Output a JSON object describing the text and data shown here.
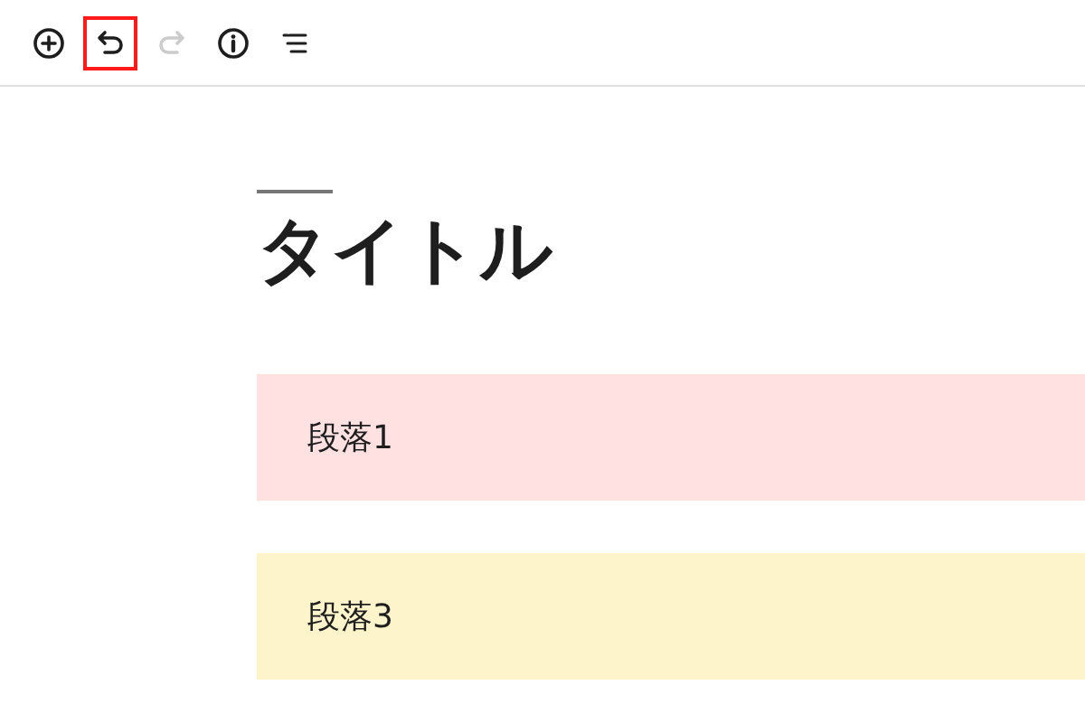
{
  "toolbar": [
    {
      "kind": "add",
      "disabled": false,
      "highlighted": false
    },
    {
      "kind": "undo",
      "disabled": false,
      "highlighted": true
    },
    {
      "kind": "redo",
      "disabled": true,
      "highlighted": false
    },
    {
      "kind": "info",
      "disabled": false,
      "highlighted": false
    },
    {
      "kind": "list",
      "disabled": false,
      "highlighted": false
    }
  ],
  "title": "タイトル",
  "blocks": [
    {
      "text": "段落1",
      "color": "#ffe1e1"
    },
    {
      "text": "段落3",
      "color": "#fdf4cb"
    }
  ]
}
